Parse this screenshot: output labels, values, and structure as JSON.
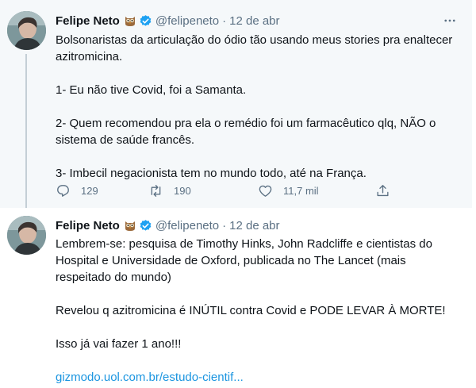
{
  "tweets": [
    {
      "author_name": "Felipe Neto",
      "handle": "@felipeneto",
      "separator": "·",
      "date": "12 de abr",
      "paragraphs": [
        "Bolsonaristas da articulação do ódio tão usando meus stories pra enaltecer azitromicina.",
        "1- Eu não tive Covid, foi a Samanta.",
        "2- Quem recomendou pra ela o remédio foi um farmacêutico qlq, NÃO o sistema de saúde francês.",
        "3- Imbecil negacionista tem no mundo todo, até na França."
      ],
      "actions": {
        "replies": "129",
        "retweets": "190",
        "likes": "11,7 mil"
      }
    },
    {
      "author_name": "Felipe Neto",
      "handle": "@felipeneto",
      "separator": "·",
      "date": "12 de abr",
      "paragraphs": [
        "Lembrem-se: pesquisa de Timothy Hinks, John Radcliffe e cientistas do Hospital e Universidade de Oxford, publicada no The Lancet (mais respeitado do mundo)",
        "Revelou q azitromicina é INÚTIL contra Covid e PODE LEVAR À MORTE!",
        "Isso já vai fazer 1 ano!!!"
      ],
      "link": "gizmodo.uol.com.br/estudo-cientif..."
    }
  ],
  "icons": {
    "author_emoji": "owl-emoji-icon",
    "verified": "verified-badge-icon",
    "more": "more-options-icon",
    "reply": "reply-icon",
    "retweet": "retweet-icon",
    "like": "heart-icon",
    "share": "share-icon"
  },
  "colors": {
    "link": "#1b95e0",
    "verified": "#1da1f2",
    "secondary_text": "#5b7083",
    "highlight_background": "#f5f8fa"
  }
}
